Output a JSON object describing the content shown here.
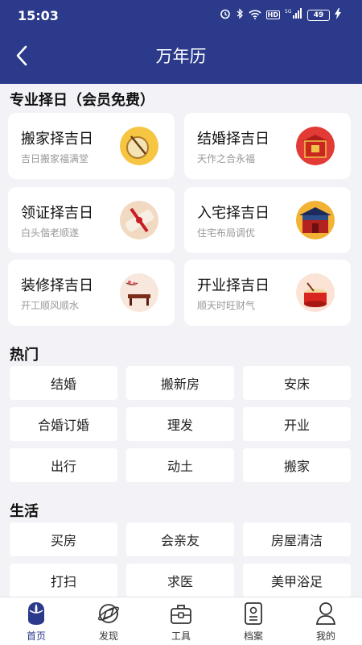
{
  "status": {
    "time": "15:03",
    "battery": "49",
    "network": "5G",
    "hd": "HD"
  },
  "header": {
    "title": "万年历"
  },
  "zeri": {
    "title": "专业择日（会员免费）",
    "cards": [
      {
        "title": "搬家择吉日",
        "subtitle": "吉日搬家福满堂",
        "icon": "drum-icon"
      },
      {
        "title": "结婚择吉日",
        "subtitle": "天作之合永福",
        "icon": "wedding-chest-icon"
      },
      {
        "title": "领证择吉日",
        "subtitle": "白头偕老顺遂",
        "icon": "gift-ribbon-icon"
      },
      {
        "title": "入宅择吉日",
        "subtitle": "住宅布局调优",
        "icon": "palace-gate-icon"
      },
      {
        "title": "装修择吉日",
        "subtitle": "开工顺风顺水",
        "icon": "table-icon"
      },
      {
        "title": "开业择吉日",
        "subtitle": "顺天时旺财气",
        "icon": "lion-drum-icon"
      }
    ]
  },
  "hot": {
    "title": "热门",
    "items": [
      "结婚",
      "搬新房",
      "安床",
      "合婚订婚",
      "理发",
      "开业",
      "出行",
      "动土",
      "搬家"
    ]
  },
  "life": {
    "title": "生活",
    "items": [
      "买房",
      "会亲友",
      "房屋清洁",
      "打扫",
      "求医",
      "美甲浴足"
    ]
  },
  "tabbar": {
    "active": 0,
    "tabs": [
      {
        "label": "首页",
        "icon": "home-icon"
      },
      {
        "label": "发现",
        "icon": "discover-icon"
      },
      {
        "label": "工具",
        "icon": "toolbox-icon"
      },
      {
        "label": "档案",
        "icon": "archive-icon"
      },
      {
        "label": "我的",
        "icon": "profile-icon"
      }
    ]
  }
}
